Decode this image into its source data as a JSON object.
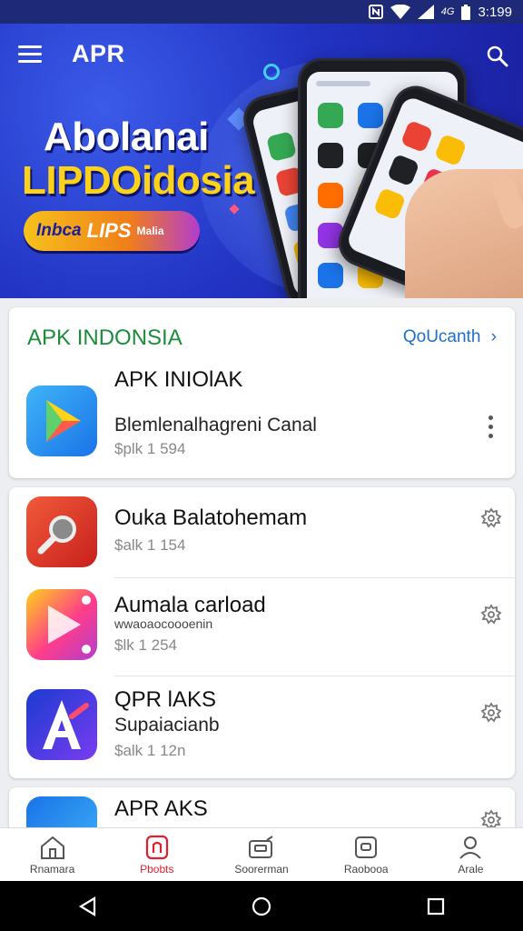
{
  "status_bar": {
    "time": "3:199"
  },
  "header": {
    "app_title": "APR"
  },
  "banner": {
    "headline_line1": "Abolanai",
    "headline_line2": "LIPDOidosia",
    "badge_part1": "Inbca",
    "badge_part2": "LIPS",
    "badge_part3": "Malia"
  },
  "featured": {
    "section_title": "APK INDONSIA",
    "link_label": "QoUcanth",
    "app": {
      "name": "APK INIOlAK",
      "subtitle": "Blemlenalhagreni Canal",
      "meta": "$plk 1 594"
    }
  },
  "app_list": [
    {
      "name": "Ouka Balatohemam",
      "meta": "$alk 1 154"
    },
    {
      "name": "Aumala carload",
      "subtitle": "wwaoaocoooenin",
      "meta": "$lk 1 254"
    },
    {
      "name": "QPR lAKS",
      "subtitle": "Supaiacianb",
      "meta": "$alk 1 12n"
    }
  ],
  "partial_item": {
    "name": "APR AKS"
  },
  "bottom_nav": [
    {
      "label": "Rnamara",
      "icon": "home-icon"
    },
    {
      "label": "Pbobts",
      "icon": "apps-icon",
      "active": true
    },
    {
      "label": "Soorerman",
      "icon": "wallet-icon"
    },
    {
      "label": "Raobooa",
      "icon": "chat-icon"
    },
    {
      "label": "Arale",
      "icon": "person-icon"
    }
  ],
  "colors": {
    "banner_blue": "#2234c4",
    "section_title_green": "#1b8c3a",
    "link_blue": "#1e6fc8",
    "active_tab_red": "#e02030"
  }
}
